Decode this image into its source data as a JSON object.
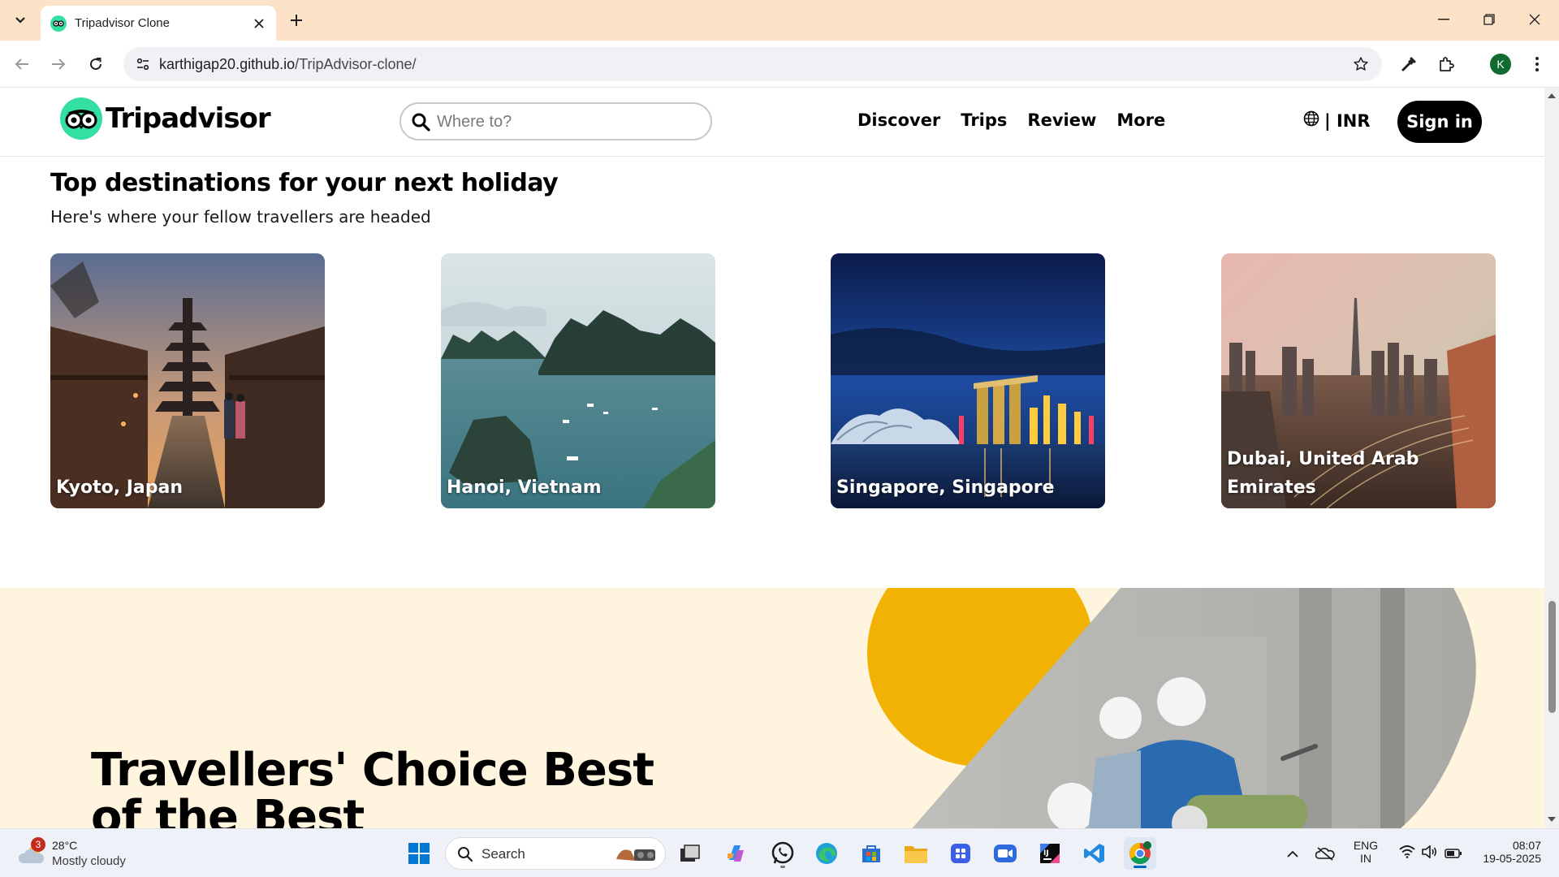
{
  "browser": {
    "tab_title": "Tripadvisor Clone",
    "url_host": "karthigap20.github.io",
    "url_path": "/TripAdvisor-clone/",
    "profile_initial": "K"
  },
  "site": {
    "logo_text": "Tripadvisor",
    "search_placeholder": "Where to?",
    "nav": [
      "Discover",
      "Trips",
      "Review",
      "More"
    ],
    "currency": "| INR",
    "signin_label": "Sign in"
  },
  "destinations": {
    "title": "Top destinations for your next holiday",
    "subtitle": "Here's where your fellow travellers are headed",
    "cards": [
      {
        "label": "Kyoto, Japan"
      },
      {
        "label": "Hanoi, Vietnam"
      },
      {
        "label": "Singapore, Singapore"
      },
      {
        "label": "Dubai, United Arab Emirates"
      }
    ]
  },
  "promo": {
    "title": "Travellers' Choice Best of the Best",
    "accent_color": "#f2b203",
    "background_color": "#fff4dd"
  },
  "taskbar": {
    "weather_badge": "3",
    "temperature": "28°C",
    "condition": "Mostly cloudy",
    "search_label": "Search",
    "lang_line1": "ENG",
    "lang_line2": "IN",
    "time": "08:07",
    "date": "19-05-2025"
  },
  "colors": {
    "brand": "#34e0a1",
    "tabbar": "#fce3c8",
    "signin_bg": "#000000"
  }
}
